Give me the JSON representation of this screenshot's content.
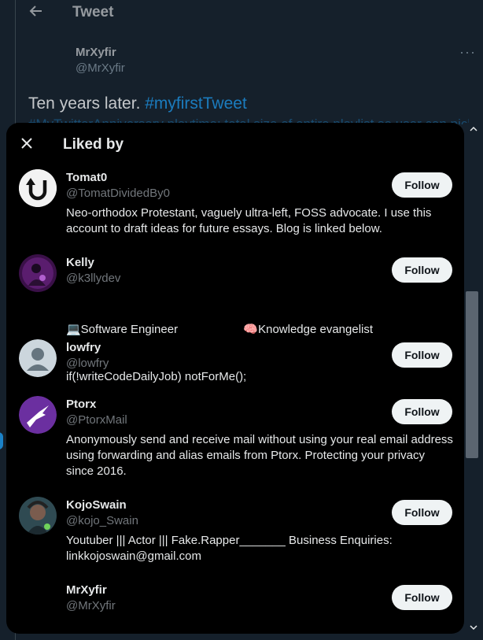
{
  "background": {
    "title": "Tweet",
    "author_name": "MrXyfir",
    "author_handle": "@MrXyfir",
    "more": "···",
    "text_plain": "Ten years later. ",
    "text_hashtag": "#myfirstTweet",
    "text_line2": "#MyTwitterAnniversary playtime: total size of entire playlist so user can pick the"
  },
  "modal": {
    "title": "Liked by",
    "follow_label": "Follow"
  },
  "users": [
    {
      "name": "Tomat0",
      "handle": "@TomatDividedBy0",
      "bio_lines": [
        "Neo-orthodox Protestant, vaguely ultra-left, FOSS advocate. I use this",
        "account to draft ideas for future essays. Blog is linked below."
      ],
      "avatar": "tomat0-logo-avatar"
    },
    {
      "name": "Kelly",
      "handle": "@k3llydev",
      "bio_lines": [
        "💻Software Engineer                    🧠Knowledge evangelist",
        "if(!writeCodeDailyJob) notForMe();"
      ],
      "avatar": "kelly-photo-avatar"
    },
    {
      "name": "lowfry",
      "handle": "@lowfry",
      "bio_lines": [],
      "avatar": "default-profile-avatar"
    },
    {
      "name": "Ptorx",
      "handle": "@PtorxMail",
      "bio_lines": [
        "Anonymously send and receive mail without using your real email address",
        "using forwarding and alias emails from Ptorx. Protecting your privacy",
        "since 2016."
      ],
      "avatar": "ptorx-pterodactyl-avatar"
    },
    {
      "name": "KojoSwain",
      "handle": "@kojo_Swain",
      "bio_lines": [
        "Youtuber ||| Actor ||| Fake.Rapper_______ Business Enquiries:",
        "linkkojoswain@gmail.com"
      ],
      "avatar": "kojo-photo-avatar"
    },
    {
      "name": "MrXyfir",
      "handle": "@MrXyfir",
      "bio_lines": [],
      "avatar": "none"
    }
  ],
  "colors": {
    "page_bg": "#15202b",
    "modal_bg": "#000000",
    "accent": "#1d9bf0",
    "follow_bg": "#eff3f4",
    "handle": "#71767b"
  }
}
